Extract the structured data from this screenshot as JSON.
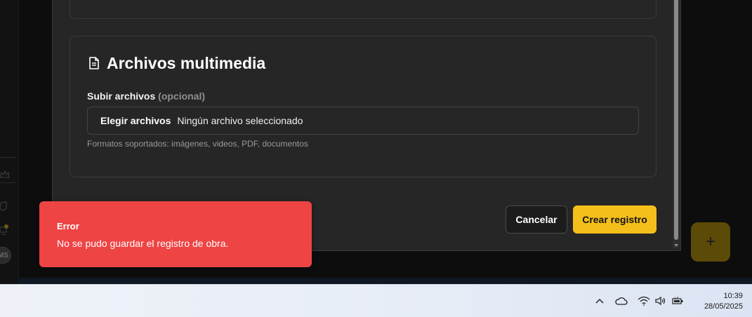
{
  "media_section": {
    "title": "Archivos multimedia",
    "icon": "document-icon",
    "upload_label": "Subir archivos",
    "upload_optional": "(opcional)",
    "choose_button": "Elegir archivos",
    "file_status": "Ningún archivo seleccionado",
    "help_text": "Formatos soportados: imágenes, videos, PDF, documentos"
  },
  "actions": {
    "cancel_label": "Cancelar",
    "create_label": "Crear registro"
  },
  "fab": {
    "label": "+"
  },
  "background": {
    "avatar_initials": "MS"
  },
  "toast": {
    "title": "Error",
    "message": "No se pudo guardar el registro de obra."
  },
  "taskbar": {
    "time": "10:39",
    "date": "28/05/2025",
    "tray_icons": [
      "chevron-up-icon",
      "cloud-icon",
      "wifi-icon",
      "volume-icon",
      "battery-icon"
    ]
  },
  "colors": {
    "accent": "#f5bf1b",
    "error": "#ef4444",
    "modal_bg": "#262626"
  }
}
